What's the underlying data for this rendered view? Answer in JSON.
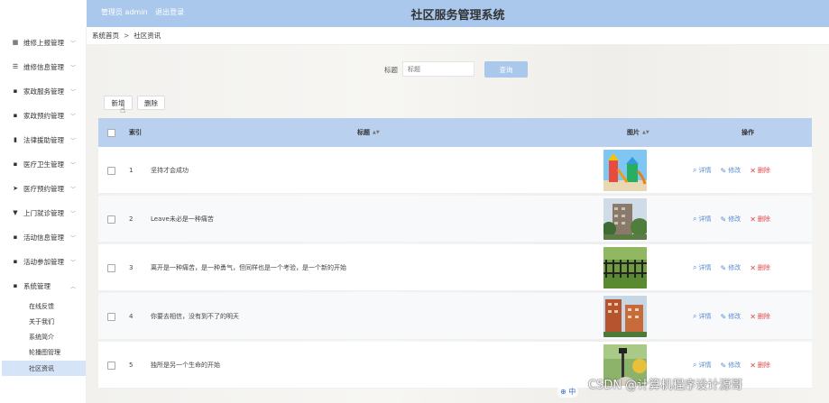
{
  "header": {
    "admin_role": "管理员 admin",
    "logout": "退出登录",
    "title": "社区服务管理系统"
  },
  "sidebar": {
    "items": [
      {
        "label": "维修上报管理",
        "icon": "grid-icon"
      },
      {
        "label": "维修信息管理",
        "icon": "sliders-icon"
      },
      {
        "label": "家政服务管理",
        "icon": "apps-icon"
      },
      {
        "label": "家政预约管理",
        "icon": "apps-icon"
      },
      {
        "label": "法律援助管理",
        "icon": "bar-chart-icon"
      },
      {
        "label": "医疗卫生管理",
        "icon": "apps-icon"
      },
      {
        "label": "医疗预约管理",
        "icon": "send-icon"
      },
      {
        "label": "上门就诊管理",
        "icon": "pin-icon"
      },
      {
        "label": "活动信息管理",
        "icon": "apps-icon"
      },
      {
        "label": "活动参加管理",
        "icon": "apps-icon"
      },
      {
        "label": "系统管理",
        "icon": "apps-icon"
      }
    ],
    "sub_items": [
      "在线反馈",
      "关于我们",
      "系统简介",
      "轮播图管理",
      "社区资讯"
    ]
  },
  "breadcrumb": {
    "home": "系统首页",
    "sep": ">",
    "current": "社区资讯"
  },
  "search": {
    "label": "标题",
    "placeholder": "标题",
    "button": "查询"
  },
  "toolbar": {
    "add": "新增",
    "delete": "删除"
  },
  "table": {
    "headers": {
      "index": "索引",
      "title": "标题",
      "image": "图片",
      "actions": "操作"
    },
    "actions": {
      "detail": "详情",
      "edit": "修改",
      "delete": "删除"
    },
    "rows": [
      {
        "index": "1",
        "title": "坚持才会成功"
      },
      {
        "index": "2",
        "title": "Leave未必是一种痛苦"
      },
      {
        "index": "3",
        "title": "离开是一种痛苦，是一种勇气，但同样也是一个考验，是一个新的开始"
      },
      {
        "index": "4",
        "title": "你要去相信，没有到不了的明天"
      },
      {
        "index": "5",
        "title": "独所是另一个生命的开始"
      }
    ]
  },
  "watermark": "CSDN @计算机程序设计源哥",
  "ime": "中"
}
